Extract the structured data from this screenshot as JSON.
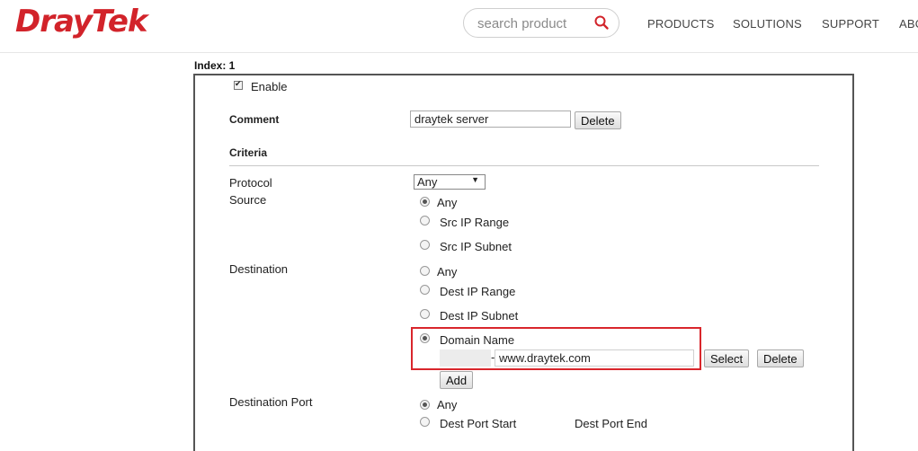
{
  "header": {
    "logo": "DrayTek",
    "search_placeholder": "search product",
    "nav": [
      "PRODUCTS",
      "SOLUTIONS",
      "SUPPORT",
      "ABO"
    ]
  },
  "colors": {
    "brand": "#d2232a",
    "highlight": "#d9262c"
  },
  "form": {
    "index_label": "Index: 1",
    "enable_label": "Enable",
    "comment_label": "Comment",
    "comment_value": "draytek server",
    "delete_label": "Delete",
    "criteria_label": "Criteria",
    "protocol_label": "Protocol",
    "protocol_value": "Any",
    "source_label": "Source",
    "source_options": [
      "Any",
      "Src IP Range",
      "Src IP Subnet"
    ],
    "destination_label": "Destination",
    "destination_options": [
      "Any",
      "Dest IP Range",
      "Dest IP Subnet",
      "Domain Name"
    ],
    "domain_value": "www.draytek.com",
    "domain_separator": "-",
    "select_label": "Select",
    "add_label": "Add",
    "dest_port_label": "Destination Port",
    "dest_port_any": "Any",
    "dest_port_start": "Dest Port Start",
    "dest_port_end": "Dest Port End"
  }
}
